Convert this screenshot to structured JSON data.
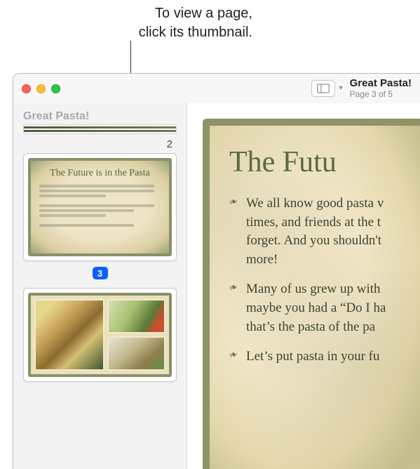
{
  "callout": {
    "line1": "To view a page,",
    "line2": "click its thumbnail."
  },
  "document": {
    "title": "Great Pasta!",
    "page_info": "Page 3 of 5"
  },
  "sidebar": {
    "title": "Great Pasta!",
    "pages": {
      "p2_label": "2",
      "p3_badge": "3",
      "p3_heading": "The Future is in the Pasta"
    }
  },
  "main": {
    "heading": "The Futu",
    "bullets": [
      "We all know good pasta v\ntimes, and friends at the t\nforget. And you shouldn't\nmore!",
      "Many of us grew up with\nmaybe you had a “Do I ha\nthat’s the pasta of the pa",
      "Let’s put pasta in your fu"
    ]
  }
}
